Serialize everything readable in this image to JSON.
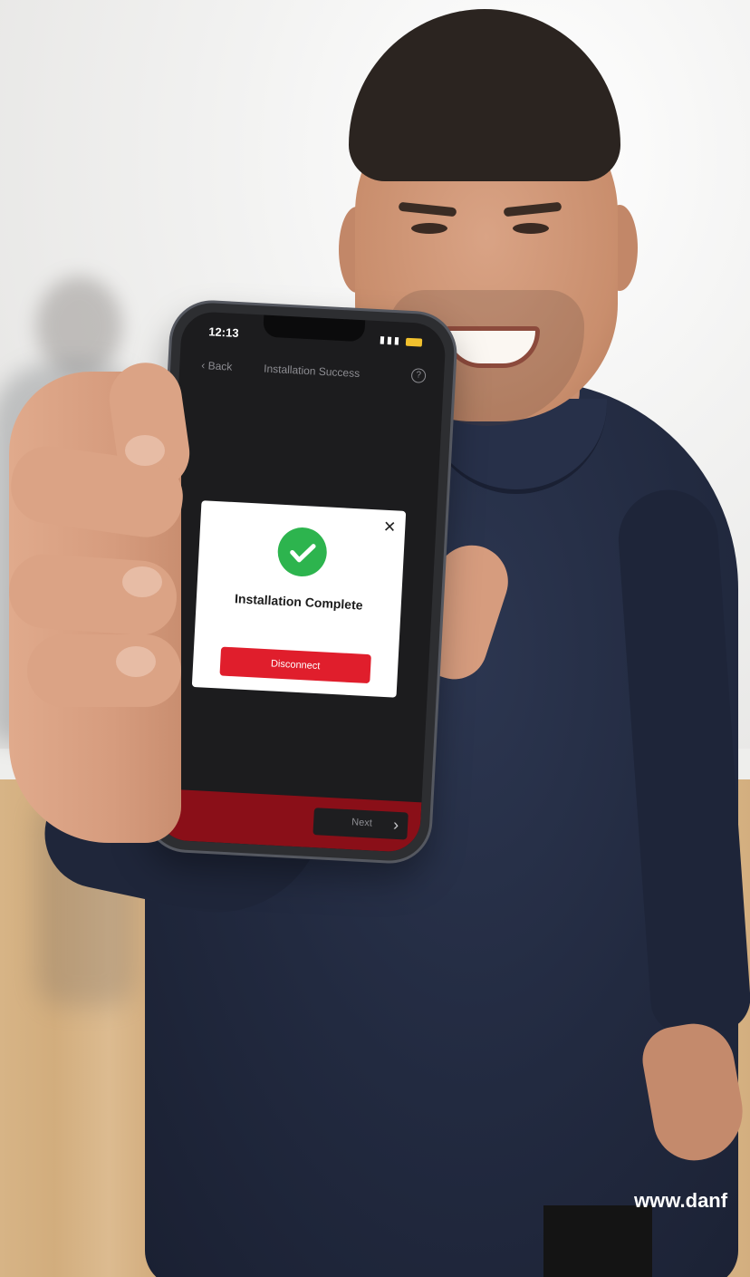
{
  "phone": {
    "status_time": "12:13",
    "nav_back_label": "Back",
    "screen_title": "Installation Success",
    "help_symbol": "?",
    "modal": {
      "close_symbol": "✕",
      "title": "Installation Complete",
      "button_label": "Disconnect"
    },
    "next_label": "Next",
    "next_arrow": "›"
  },
  "footer": {
    "url": "www.danf"
  },
  "colors": {
    "success_green": "#2db44e",
    "accent_red": "#e01e2c",
    "sweater_navy": "#222a40"
  },
  "icons": [
    "location-arrow-icon",
    "signal-icon",
    "wifi-icon",
    "battery-icon",
    "back-chevron-icon",
    "help-icon",
    "close-icon",
    "check-icon",
    "chevron-right-icon"
  ]
}
